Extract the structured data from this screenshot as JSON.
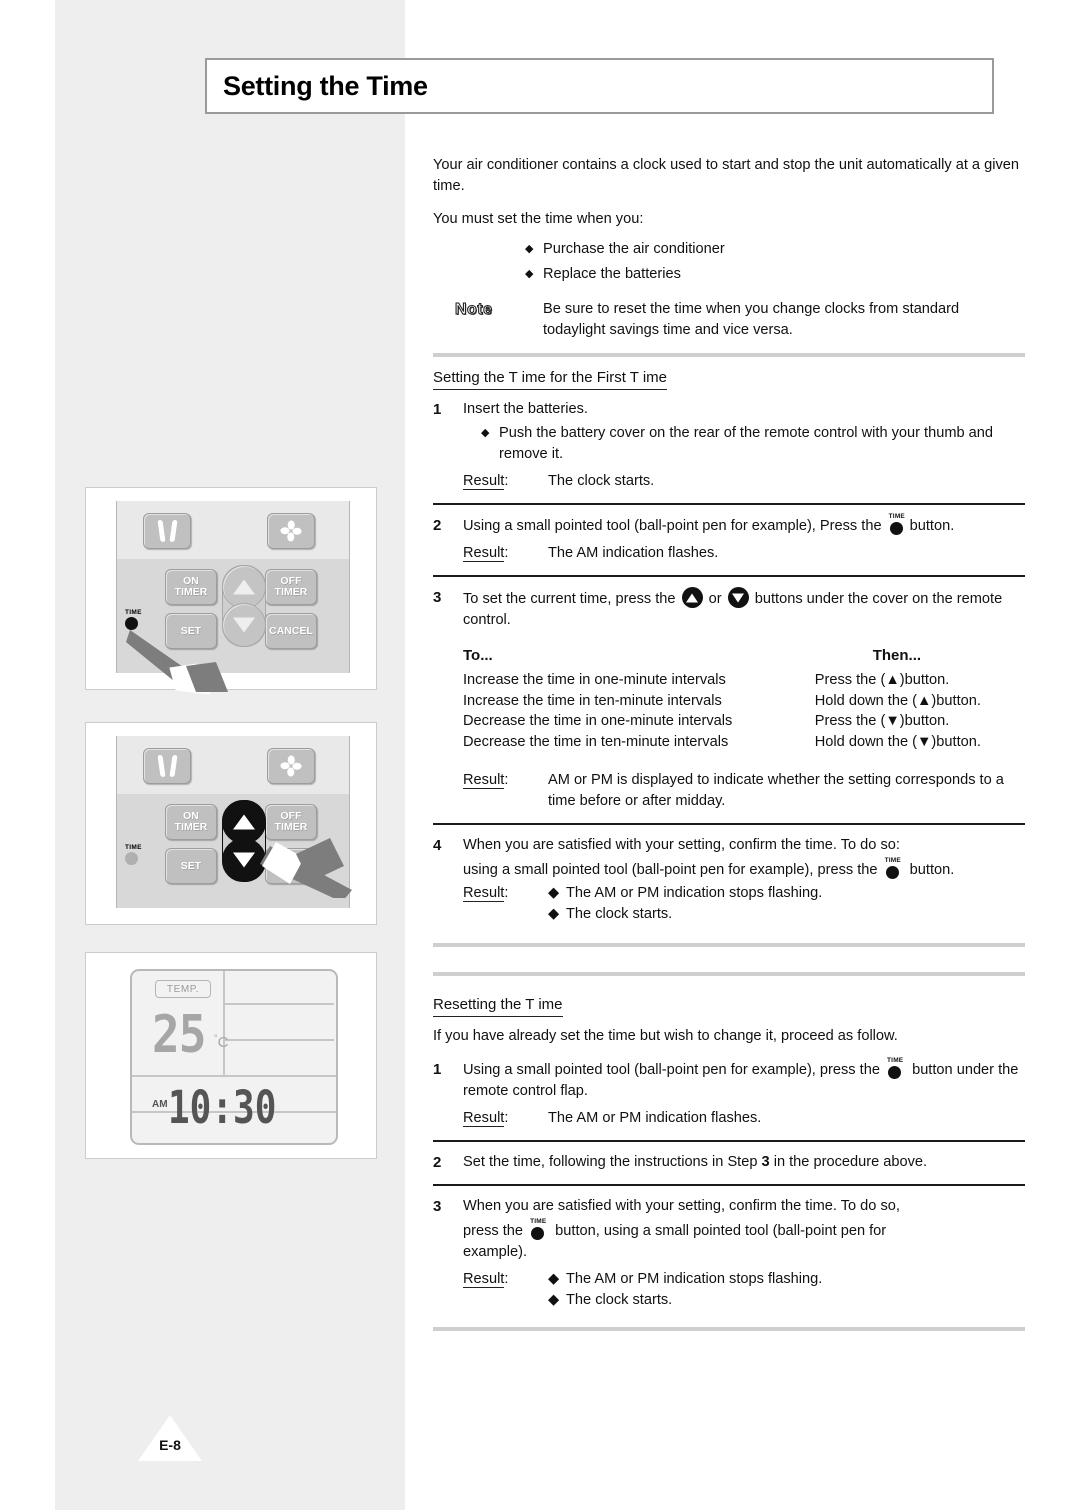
{
  "page": {
    "title": "Setting the Time",
    "page_number": "E-8"
  },
  "intro": {
    "para1": "Your air conditioner contains a clock used to start and stop the unit automatically at a given time.",
    "para2": "You must set the time when you:",
    "bullets": [
      "Purchase the air conditioner",
      "Replace the batteries"
    ],
    "note_label": "Note",
    "note_text": "Be sure to reset the time when you change clocks from standard todaylight savings time and vice versa."
  },
  "first_time": {
    "heading": "Setting the T ime for the First T ime",
    "step1": {
      "num": "1",
      "text": "Insert the batteries.",
      "bullet": "Push the battery cover on the rear of the remote control with your thumb and remove it.",
      "result_label": "Result",
      "result_colon": ":",
      "result_text": "The clock starts."
    },
    "step2": {
      "num": "2",
      "text_before": "Using a small pointed tool (ball-point pen for example), Press the",
      "text_after": "button.",
      "result_label": "Result",
      "result_colon": ":",
      "result_text": "The AM indication flashes."
    },
    "step3": {
      "num": "3",
      "text_before": "To set the current time, press the",
      "text_middle": "or",
      "text_after": "buttons under the cover on the remote control.",
      "table": {
        "col_to": "To...",
        "col_then": "Then...",
        "rows": [
          {
            "to": "Increase the time in one-minute intervals",
            "then": "Press the (▲)button."
          },
          {
            "to": "Increase the time in ten-minute intervals",
            "then": "Hold down the (▲)button."
          },
          {
            "to": "Decrease the time in one-minute intervals",
            "then": "Press the (▼)button."
          },
          {
            "to": "Decrease the time in ten-minute intervals",
            "then": "Hold down the (▼)button."
          }
        ]
      },
      "result_label": "Result",
      "result_colon": ":",
      "result_text": "AM or PM is displayed to indicate whether the setting corresponds to a time before or after midday."
    },
    "step4": {
      "num": "4",
      "line1": "When you are satisfied with your setting, confirm the time. To do so:",
      "line2_before": "using a small pointed tool (ball-point pen for example), press the",
      "line2_after": "button.",
      "result_label": "Result",
      "result_colon": ":",
      "result_bullets": [
        "The AM or PM indication stops flashing.",
        "The clock starts."
      ]
    }
  },
  "resetting": {
    "heading": "Resetting the T ime",
    "intro": "If you have already set the time but wish to change it, proceed as follow.",
    "step1": {
      "num": "1",
      "text_before": "Using a small pointed tool (ball-point pen for example), press the",
      "text_after": "button under the remote control flap.",
      "result_label": "Result",
      "result_colon": ":",
      "result_text": "The AM or PM indication flashes."
    },
    "step2": {
      "num": "2",
      "text_a": "Set the time, following the instructions in Step",
      "text_bold": "3",
      "text_b": "in the procedure above."
    },
    "step3": {
      "num": "3",
      "line1": "When you are satisfied with your setting, confirm the time. To do so,",
      "line2_before": "press the",
      "line2_after": "button, using a small pointed tool (ball-point pen for",
      "line3": "example).",
      "result_label": "Result",
      "result_colon": ":",
      "result_bullets": [
        "The AM or PM indication stops flashing.",
        "The clock starts."
      ]
    }
  },
  "figures": {
    "remote_keys": {
      "on_timer": "ON\nTIMER",
      "on_timer_l1": "ON",
      "on_timer_l2": "TIMER",
      "off_timer_l1": "OFF",
      "off_timer_l2": "TIMER",
      "set": "SET",
      "cancel": "CANCEL",
      "time_label": "TIME"
    },
    "display": {
      "temp_label": "TEMP.",
      "temperature": "25",
      "degree": "°",
      "unit": "C",
      "meridiem": "AM",
      "time": "10:30"
    }
  },
  "symbols": {
    "diamond": "◆",
    "time_icon_label": "TIME"
  }
}
